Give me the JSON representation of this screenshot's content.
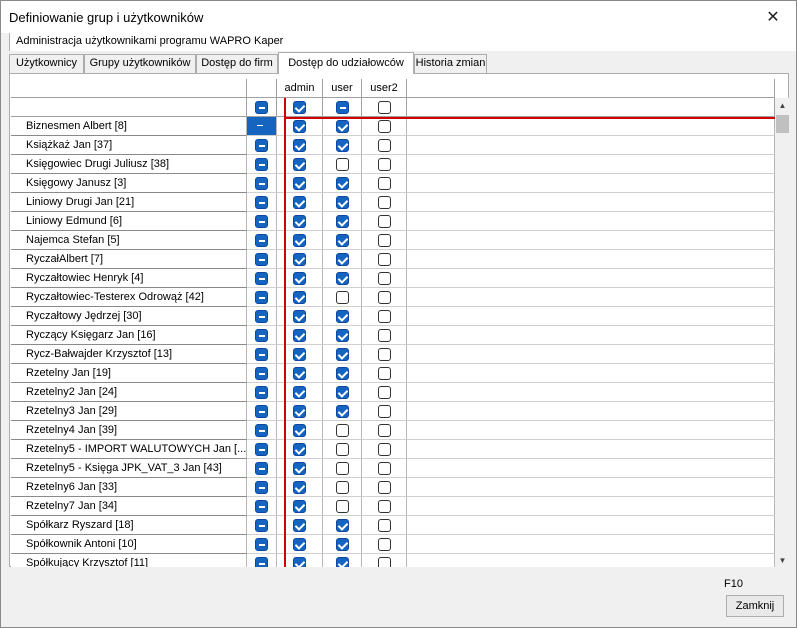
{
  "window": {
    "title": "Definiowanie grup i użytkowników",
    "subtitle": "Administracja użytkownikami programu WAPRO Kaper"
  },
  "tabs": [
    {
      "label": "Użytkownicy",
      "active": false
    },
    {
      "label": "Grupy użytkowników",
      "active": false
    },
    {
      "label": "Dostęp do firm",
      "active": false
    },
    {
      "label": "Dostęp do udziałowców",
      "active": true
    },
    {
      "label": "Historia zmian",
      "active": false
    }
  ],
  "grid": {
    "columns": [
      "admin",
      "user",
      "user2"
    ],
    "filter_row": {
      "all": "ind",
      "admin": "on",
      "user": "ind",
      "user2": "off"
    },
    "rows": [
      {
        "name": "Biznesmen Albert  [8]",
        "all": "sel",
        "admin": "on",
        "user": "on",
        "user2": "off"
      },
      {
        "name": "Książkaż Jan  [37]",
        "all": "ind",
        "admin": "on",
        "user": "on",
        "user2": "off"
      },
      {
        "name": "Księgowiec Drugi Juliusz  [38]",
        "all": "ind",
        "admin": "on",
        "user": "off",
        "user2": "off"
      },
      {
        "name": "Księgowy Janusz  [3]",
        "all": "ind",
        "admin": "on",
        "user": "on",
        "user2": "off"
      },
      {
        "name": "Liniowy Drugi Jan  [21]",
        "all": "ind",
        "admin": "on",
        "user": "on",
        "user2": "off"
      },
      {
        "name": "Liniowy Edmund  [6]",
        "all": "ind",
        "admin": "on",
        "user": "on",
        "user2": "off"
      },
      {
        "name": "Najemca Stefan  [5]",
        "all": "ind",
        "admin": "on",
        "user": "on",
        "user2": "off"
      },
      {
        "name": "RyczałAlbert  [7]",
        "all": "ind",
        "admin": "on",
        "user": "on",
        "user2": "off"
      },
      {
        "name": "Ryczałtowiec Henryk  [4]",
        "all": "ind",
        "admin": "on",
        "user": "on",
        "user2": "off"
      },
      {
        "name": "Ryczałtowiec-Testerex Odrowąż  [42]",
        "all": "ind",
        "admin": "on",
        "user": "off",
        "user2": "off"
      },
      {
        "name": "Ryczałtowy Jędrzej  [30]",
        "all": "ind",
        "admin": "on",
        "user": "on",
        "user2": "off"
      },
      {
        "name": "Ryczący Księgarz Jan  [16]",
        "all": "ind",
        "admin": "on",
        "user": "on",
        "user2": "off"
      },
      {
        "name": "Rycz-Bałwajder Krzysztof  [13]",
        "all": "ind",
        "admin": "on",
        "user": "on",
        "user2": "off"
      },
      {
        "name": "Rzetelny Jan  [19]",
        "all": "ind",
        "admin": "on",
        "user": "on",
        "user2": "off"
      },
      {
        "name": "Rzetelny2 Jan  [24]",
        "all": "ind",
        "admin": "on",
        "user": "on",
        "user2": "off"
      },
      {
        "name": "Rzetelny3 Jan  [29]",
        "all": "ind",
        "admin": "on",
        "user": "on",
        "user2": "off"
      },
      {
        "name": "Rzetelny4 Jan  [39]",
        "all": "ind",
        "admin": "on",
        "user": "off",
        "user2": "off"
      },
      {
        "name": "Rzetelny5 - IMPORT WALUTOWYCH Jan  [...",
        "all": "ind",
        "admin": "on",
        "user": "off",
        "user2": "off"
      },
      {
        "name": "Rzetelny5 - Księga JPK_VAT_3 Jan  [43]",
        "all": "ind",
        "admin": "on",
        "user": "off",
        "user2": "off"
      },
      {
        "name": "Rzetelny6 Jan  [33]",
        "all": "ind",
        "admin": "on",
        "user": "off",
        "user2": "off"
      },
      {
        "name": "Rzetelny7 Jan  [34]",
        "all": "ind",
        "admin": "on",
        "user": "off",
        "user2": "off"
      },
      {
        "name": "Spółkarz Ryszard  [18]",
        "all": "ind",
        "admin": "on",
        "user": "on",
        "user2": "off"
      },
      {
        "name": "Spółkownik Antoni  [10]",
        "all": "ind",
        "admin": "on",
        "user": "on",
        "user2": "off"
      },
      {
        "name": "Spółkujący Krzysztof  [11]",
        "all": "ind",
        "admin": "on",
        "user": "on",
        "user2": "off"
      }
    ]
  },
  "footer": {
    "shortcut": "F10",
    "close_label": "Zamknij"
  }
}
